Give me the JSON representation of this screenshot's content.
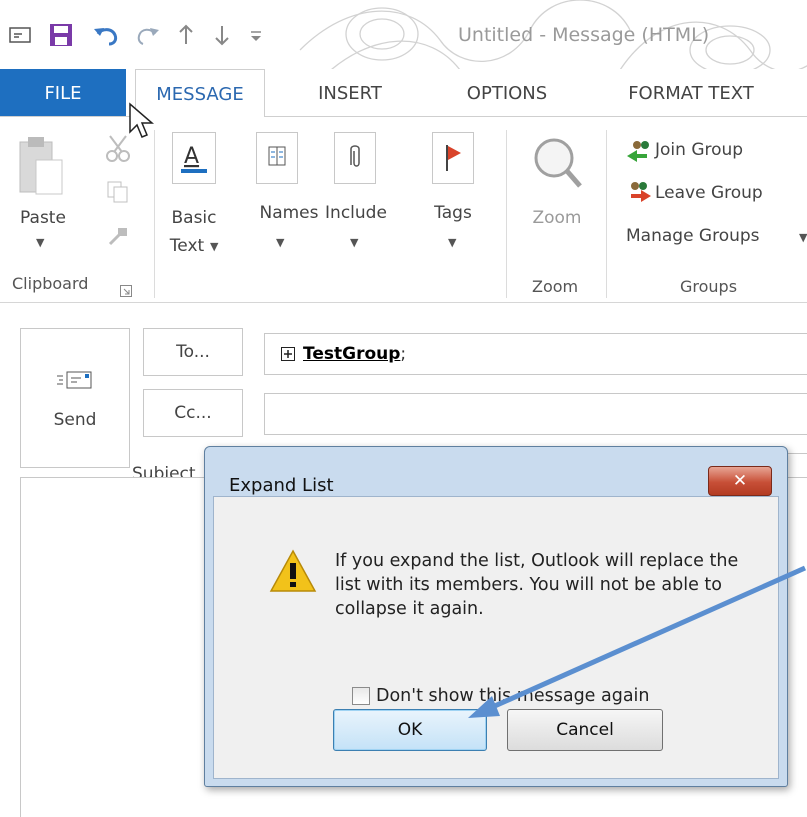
{
  "window": {
    "title": "Untitled - Message (HTML)"
  },
  "tabs": [
    {
      "label": "FILE"
    },
    {
      "label": "MESSAGE"
    },
    {
      "label": "INSERT"
    },
    {
      "label": "OPTIONS"
    },
    {
      "label": "FORMAT TEXT"
    }
  ],
  "ribbon": {
    "clipboard": {
      "paste": "Paste",
      "group": "Clipboard"
    },
    "basic_text": {
      "line1": "Basic",
      "line2": "Text"
    },
    "names": {
      "label": "Names"
    },
    "include": {
      "label": "Include"
    },
    "tags": {
      "label": "Tags"
    },
    "zoom": {
      "label": "Zoom",
      "group": "Zoom"
    },
    "groups": {
      "join": "Join Group",
      "leave": "Leave Group",
      "manage": "Manage Groups",
      "group": "Groups"
    }
  },
  "compose": {
    "send": "Send",
    "to_button": "To...",
    "cc_button": "Cc...",
    "subject_label": "Subject",
    "to_value": "TestGroup",
    "to_separator": ";"
  },
  "dialog": {
    "title": "Expand List",
    "close": "✕",
    "message": "If you expand the list, Outlook will replace the list with its members. You will not be able to collapse it again.",
    "checkbox_label": "Don't show this message again",
    "ok": "OK",
    "cancel": "Cancel"
  },
  "colors": {
    "file_tab": "#1e6fc0",
    "active_tab_text": "#2b68b0",
    "arrow": "#5b8fd0"
  }
}
